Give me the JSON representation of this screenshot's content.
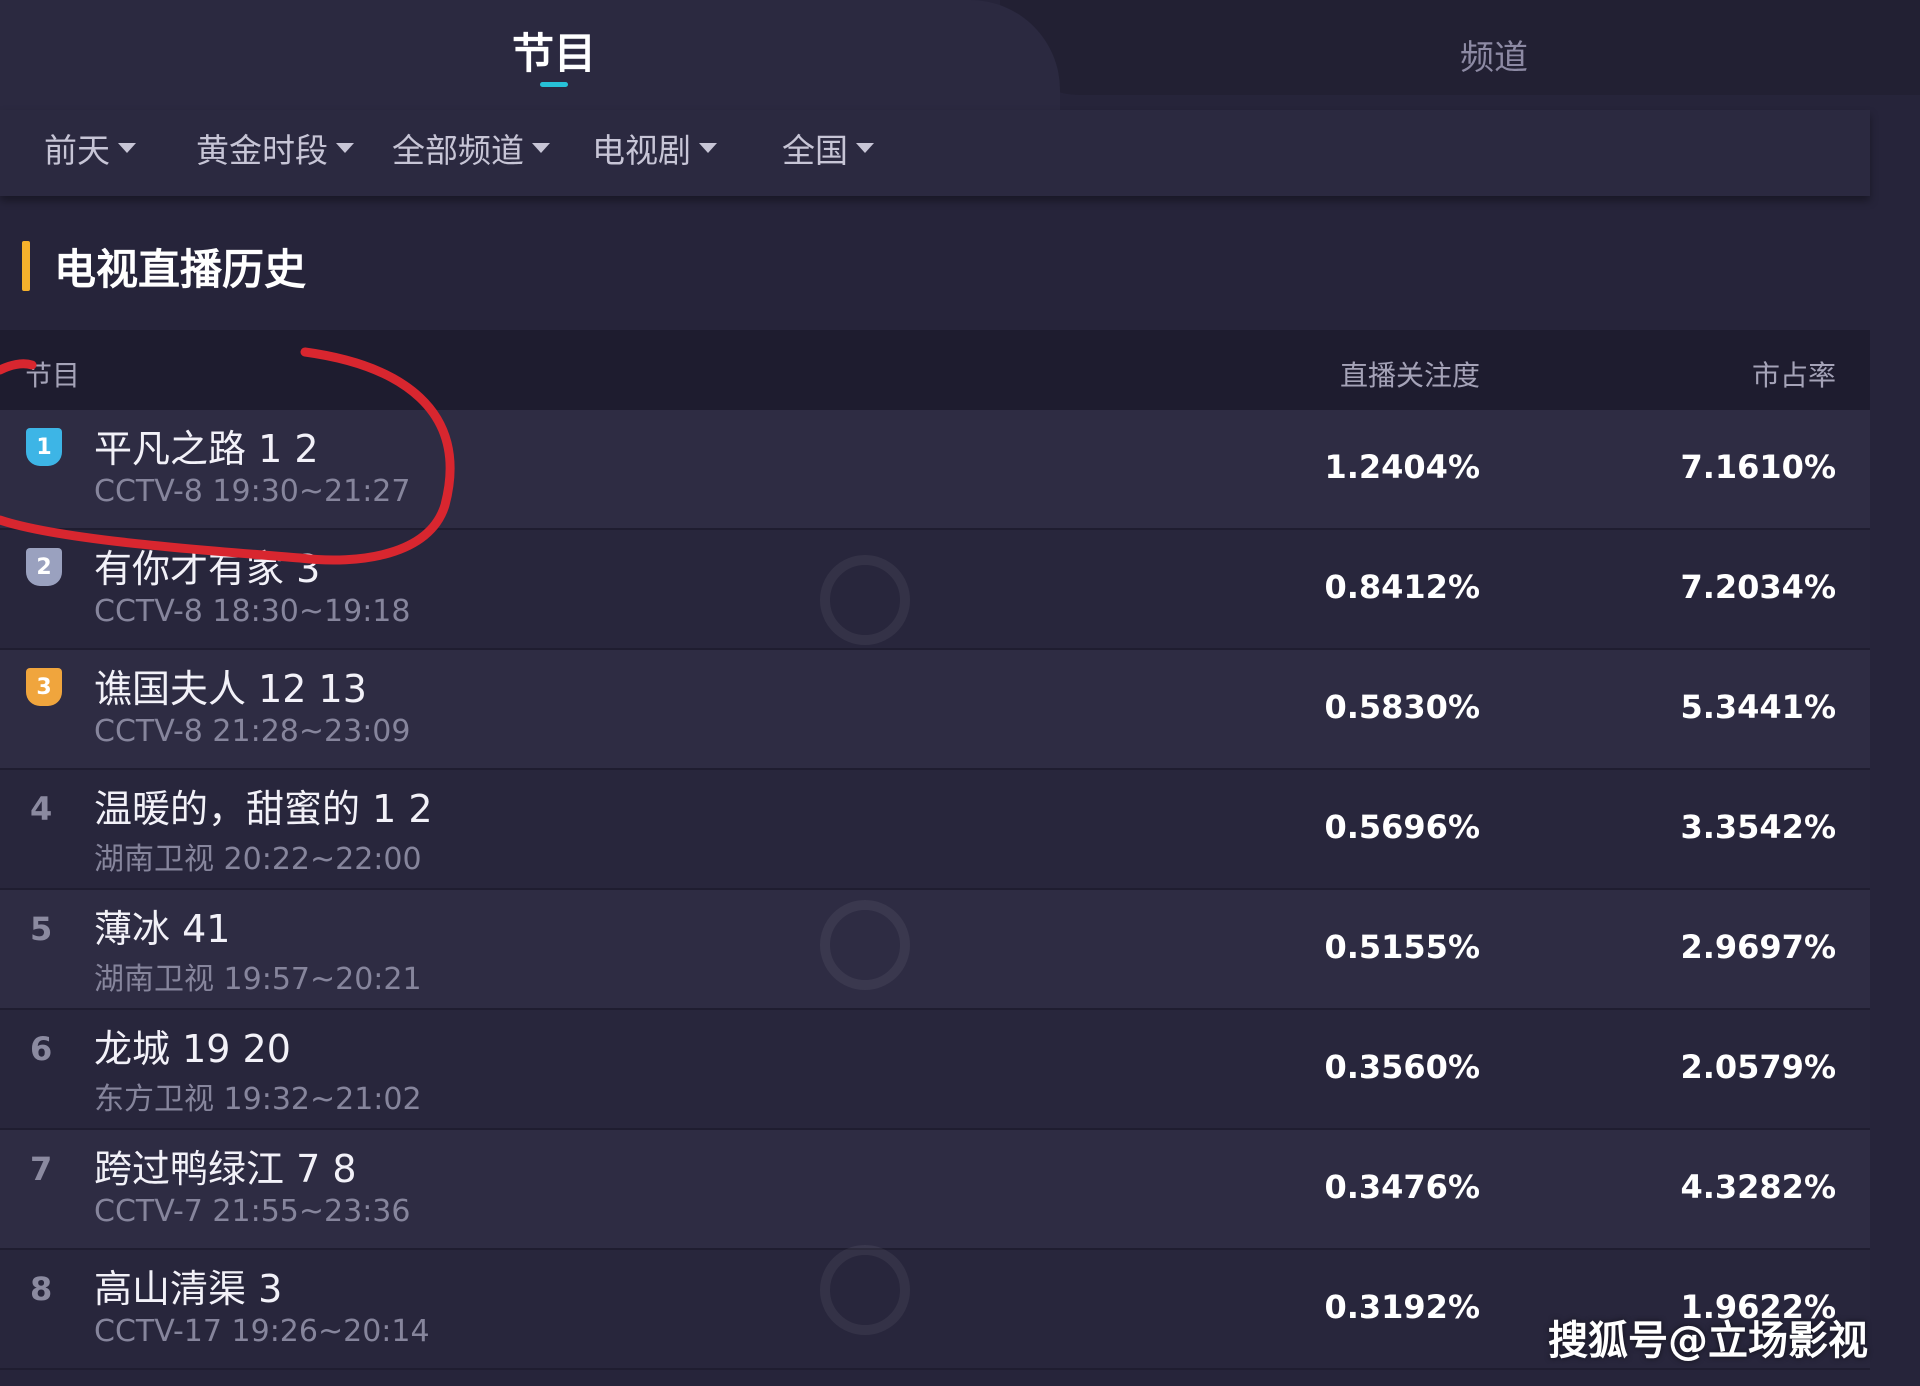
{
  "tabs": [
    {
      "label": "节目",
      "active": true
    },
    {
      "label": "频道",
      "active": false
    }
  ],
  "filters": [
    {
      "label": "前天"
    },
    {
      "label": "黄金时段"
    },
    {
      "label": "全部频道"
    },
    {
      "label": "电视剧"
    },
    {
      "label": "全国"
    }
  ],
  "section": {
    "title": "电视直播历史"
  },
  "table": {
    "columns": [
      "节目",
      "直播关注度",
      "市占率"
    ],
    "rows": [
      {
        "rank": "1",
        "title": "平凡之路 1 2",
        "channel_time": "CCTV-8 19:30~21:27",
        "attention": "1.2404%",
        "share": "7.1610%"
      },
      {
        "rank": "2",
        "title": "有你才有家 3",
        "channel_time": "CCTV-8 18:30~19:18",
        "attention": "0.8412%",
        "share": "7.2034%"
      },
      {
        "rank": "3",
        "title": "谯国夫人 12 13",
        "channel_time": "CCTV-8 21:28~23:09",
        "attention": "0.5830%",
        "share": "5.3441%"
      },
      {
        "rank": "4",
        "title": "温暖的，甜蜜的 1 2",
        "channel_time": "湖南卫视 20:22~22:00",
        "attention": "0.5696%",
        "share": "3.3542%"
      },
      {
        "rank": "5",
        "title": "薄冰 41",
        "channel_time": "湖南卫视 19:57~20:21",
        "attention": "0.5155%",
        "share": "2.9697%"
      },
      {
        "rank": "6",
        "title": "龙城 19 20",
        "channel_time": "东方卫视 19:32~21:02",
        "attention": "0.3560%",
        "share": "2.0579%"
      },
      {
        "rank": "7",
        "title": "跨过鸭绿江 7 8",
        "channel_time": "CCTV-7 21:55~23:36",
        "attention": "0.3476%",
        "share": "4.3282%"
      },
      {
        "rank": "8",
        "title": "高山清渠 3",
        "channel_time": "CCTV-17 19:26~20:14",
        "attention": "0.3192%",
        "share": "1.9622%"
      }
    ]
  },
  "footer": {
    "source": "搜狐号@立场影视"
  },
  "colors": {
    "accent": "#27c1d7",
    "section_bar": "#f5b12c",
    "annotation": "#d8262f"
  }
}
